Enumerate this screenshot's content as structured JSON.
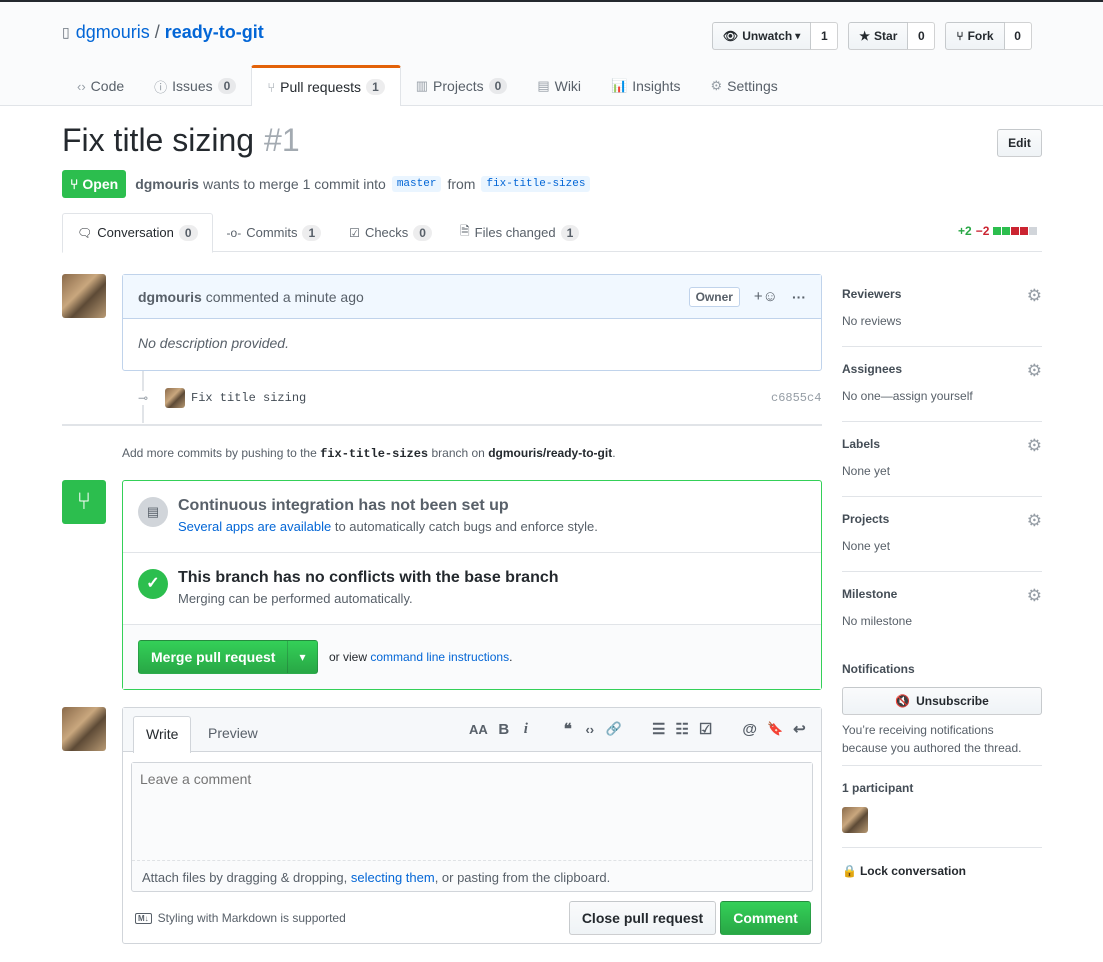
{
  "repo": {
    "owner": "dgmouris",
    "sep": "/",
    "name": "ready-to-git"
  },
  "actions": [
    {
      "label": "Unwatch",
      "count": "1",
      "icon": "eye-icon",
      "caret": "▾"
    },
    {
      "label": "Star",
      "count": "0",
      "icon": "star-icon"
    },
    {
      "label": "Fork",
      "count": "0",
      "icon": "fork-icon"
    }
  ],
  "nav": [
    {
      "label": "Code",
      "icon": "code-icon",
      "glyph": "‹›"
    },
    {
      "label": "Issues",
      "count": "0",
      "icon": "issue-icon",
      "glyph": "ⓘ"
    },
    {
      "label": "Pull requests",
      "count": "1",
      "icon": "pull-request-icon",
      "glyph": "⑂",
      "selected": true
    },
    {
      "label": "Projects",
      "count": "0",
      "icon": "project-icon",
      "glyph": "▥"
    },
    {
      "label": "Wiki",
      "icon": "book-icon",
      "glyph": "▤"
    },
    {
      "label": "Insights",
      "icon": "graph-icon",
      "glyph": "📊"
    },
    {
      "label": "Settings",
      "icon": "gear-icon",
      "glyph": "⚙"
    }
  ],
  "pr": {
    "title": "Fix title sizing",
    "number": "#1",
    "edit": "Edit",
    "state": "Open",
    "author": "dgmouris",
    "merge_text": "wants to merge 1 commit into",
    "base": "master",
    "from": "from",
    "head": "fix-title-sizes"
  },
  "tabs": [
    {
      "label": "Conversation",
      "count": "0",
      "icon": "comment-icon",
      "glyph": "🗨"
    },
    {
      "label": "Commits",
      "count": "1",
      "icon": "commit-icon",
      "glyph": "-o-"
    },
    {
      "label": "Checks",
      "count": "0",
      "icon": "checklist-icon",
      "glyph": "☑"
    },
    {
      "label": "Files changed",
      "count": "1",
      "icon": "diff-icon",
      "glyph": "🗎"
    }
  ],
  "diffstat": {
    "add": "+2",
    "del": "−2"
  },
  "comment": {
    "author": "dgmouris",
    "meta": "commented a minute ago",
    "badge": "Owner",
    "body": "No description provided.",
    "react": "+☺",
    "more": "···"
  },
  "commit": {
    "message": "Fix title sizing",
    "sha": "c6855c4"
  },
  "hint": {
    "pre": "Add more commits by pushing to the",
    "branch": "fix-title-sizes",
    "mid": "branch on",
    "repo": "dgmouris/ready-to-git",
    "end": "."
  },
  "ci": {
    "title": "Continuous integration has not been set up",
    "link": "Several apps are available",
    "rest": " to automatically catch bugs and enforce style."
  },
  "conflict": {
    "title": "This branch has no conflicts with the base branch",
    "sub": "Merging can be performed automatically."
  },
  "merge": {
    "button": "Merge pull request",
    "caret": "▾",
    "or": "or view ",
    "link": "command line instructions",
    "end": "."
  },
  "editor": {
    "write": "Write",
    "preview": "Preview",
    "placeholder": "Leave a comment",
    "attach_pre": "Attach files by dragging & dropping, ",
    "attach_link": "selecting them",
    "attach_post": ", or pasting from the clipboard.",
    "markdown": "Styling with Markdown is supported",
    "close": "Close pull request",
    "submit": "Comment",
    "toolbar": [
      {
        "name": "text-size-icon",
        "g": "AA"
      },
      {
        "name": "bold-icon",
        "g": "B"
      },
      {
        "name": "italic-icon",
        "g": "i"
      },
      {
        "name": "quote-icon",
        "g": "❝"
      },
      {
        "name": "code-icon",
        "g": "‹›"
      },
      {
        "name": "link-icon",
        "g": "🔗"
      },
      {
        "name": "unordered-list-icon",
        "g": "☰"
      },
      {
        "name": "ordered-list-icon",
        "g": "☷"
      },
      {
        "name": "task-list-icon",
        "g": "☑"
      },
      {
        "name": "mention-icon",
        "g": "@"
      },
      {
        "name": "bookmark-icon",
        "g": "🔖"
      },
      {
        "name": "reply-icon",
        "g": "↩"
      }
    ]
  },
  "sidebar": {
    "sections": [
      {
        "title": "Reviewers",
        "value": "No reviews"
      },
      {
        "title": "Assignees",
        "value": "No one—assign yourself"
      },
      {
        "title": "Labels",
        "value": "None yet"
      },
      {
        "title": "Projects",
        "value": "None yet"
      },
      {
        "title": "Milestone",
        "value": "No milestone"
      }
    ],
    "notifications": {
      "title": "Notifications",
      "button": "Unsubscribe",
      "text": "You’re receiving notifications because you authored the thread."
    },
    "participants": "1 participant",
    "lock": "Lock conversation"
  },
  "colors": {
    "green": "#2cbe4e",
    "blue": "#0366d6",
    "red": "#cb2431",
    "accent": "#e36209"
  }
}
